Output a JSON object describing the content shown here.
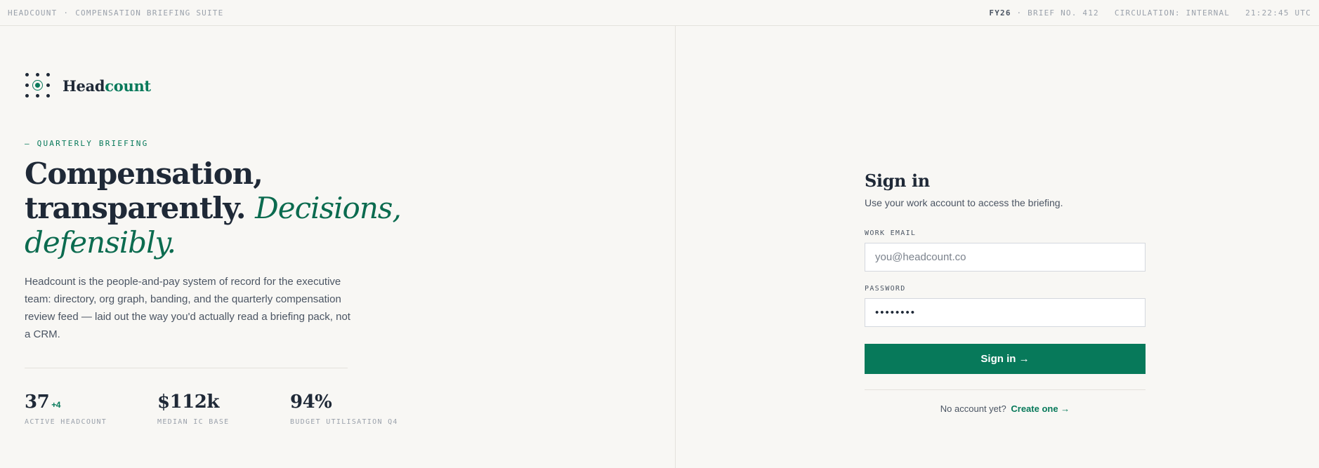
{
  "topbar": {
    "brand": "HEADCOUNT",
    "separator": "·",
    "suite": "COMPENSATION BRIEFING SUITE",
    "fiscal_year": "FY26",
    "brief": "· BRIEF NO. 412",
    "circulation": "CIRCULATION: INTERNAL",
    "clock": "21:22:45 UTC"
  },
  "brand": {
    "logo_icon": "dot-grid-logo-icon",
    "name_part1": "Head",
    "name_part2": "count",
    "accent_color": "#07795a"
  },
  "hero": {
    "eyebrow": "— QUARTERLY BRIEFING",
    "headline_line1": "Compensation,",
    "headline_line2": "transparently.",
    "headline_italic_a": "Decisions,",
    "headline_italic_b": "defensibly.",
    "lead": "Headcount is the people-and-pay system of record for the executive team: directory, org graph, banding, and the quarterly compensation review feed — laid out the way you'd actually read a briefing pack, not a CRM."
  },
  "stats": [
    {
      "value": "37",
      "delta": "+4",
      "label": "ACTIVE HEADCOUNT"
    },
    {
      "value": "$112k",
      "delta": "",
      "label": "MEDIAN IC BASE"
    },
    {
      "value": "94%",
      "delta": "",
      "label": "BUDGET UTILISATION Q4"
    }
  ],
  "signin": {
    "title": "Sign in",
    "subtitle": "Use your work account to access the briefing.",
    "email_label": "WORK EMAIL",
    "email_placeholder": "you@headcount.co",
    "email_value": "",
    "password_label": "PASSWORD",
    "password_value": "password",
    "submit_label": "Sign in →",
    "no_account": "No account yet?",
    "create_link": "Create one →"
  }
}
